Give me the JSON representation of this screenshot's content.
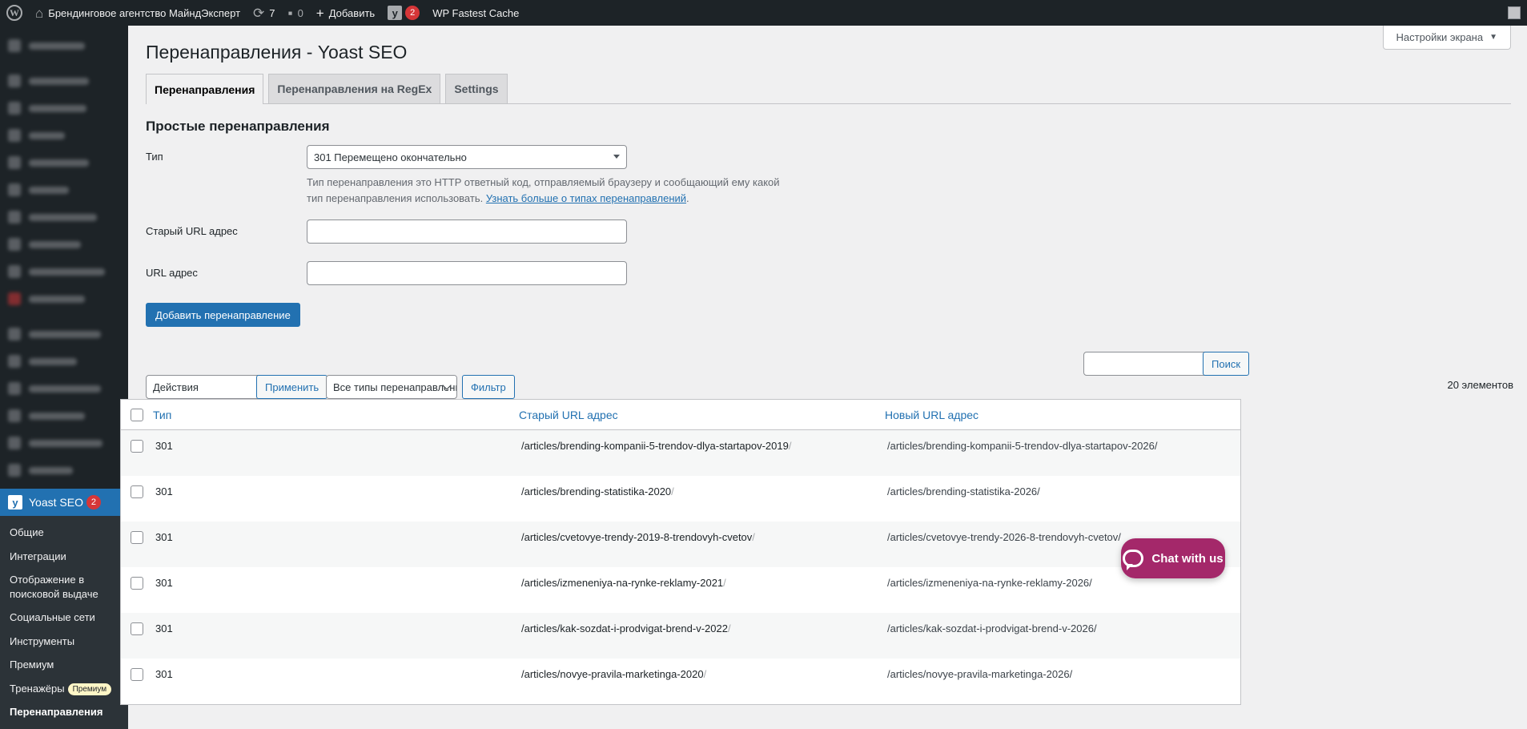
{
  "adminbar": {
    "site_name": "Брендинговое агентство МайндЭксперт",
    "updates_count": "7",
    "comments_count": "0",
    "add_label": "Добавить",
    "yoast_badge": "2",
    "cache_label": "WP Fastest Cache"
  },
  "sidebar": {
    "yoast_label": "Yoast SEO",
    "yoast_badge": "2",
    "submenu": [
      "Общие",
      "Интеграции",
      "Отображение в поисковой выдаче",
      "Социальные сети",
      "Инструменты",
      "Премиум",
      "Тренажёры",
      "Перенаправления"
    ],
    "premium_badge": "Премиум"
  },
  "header": {
    "screen_options": "Настройки экрана",
    "title": "Перенаправления - Yoast SEO"
  },
  "tabs": [
    {
      "label": "Перенаправления",
      "active": true
    },
    {
      "label": "Перенаправления на RegEx",
      "active": false
    },
    {
      "label": "Settings",
      "active": false
    }
  ],
  "form": {
    "section_title": "Простые перенаправления",
    "type_label": "Тип",
    "type_value": "301 Перемещено окончательно",
    "desc_line1": "Тип перенаправления это HTTP ответный код, отправляемый браузеру и сообщающий ему какой",
    "desc_line2": "тип перенаправления использовать.",
    "desc_link": "Узнать больше о типах перенаправлений",
    "old_url_label": "Старый URL адрес",
    "old_url_value": "",
    "url_label": "URL адрес",
    "url_value": "",
    "add_button": "Добавить перенаправление"
  },
  "list": {
    "search_button": "Поиск",
    "search_value": "",
    "bulk_action": "Действия",
    "apply_button": "Применить",
    "type_filter": "Все типы перенаправлений",
    "filter_button": "Фильтр",
    "count": "20 элементов",
    "columns": {
      "type": "Тип",
      "old": "Старый URL адрес",
      "new": "Новый URL адрес"
    },
    "rows": [
      {
        "type": "301",
        "old": "/articles/brending-kompanii-5-trendov-dlya-startapov-2019",
        "new": "/articles/brending-kompanii-5-trendov-dlya-startapov-2026/"
      },
      {
        "type": "301",
        "old": "/articles/brending-statistika-2020",
        "new": "/articles/brending-statistika-2026/"
      },
      {
        "type": "301",
        "old": "/articles/cvetovye-trendy-2019-8-trendovyh-cvetov",
        "new": "/articles/cvetovye-trendy-2026-8-trendovyh-cvetov/"
      },
      {
        "type": "301",
        "old": "/articles/izmeneniya-na-rynke-reklamy-2021",
        "new": "/articles/izmeneniya-na-rynke-reklamy-2026/"
      },
      {
        "type": "301",
        "old": "/articles/kak-sozdat-i-prodvigat-brend-v-2022",
        "new": "/articles/kak-sozdat-i-prodvigat-brend-v-2026/"
      },
      {
        "type": "301",
        "old": "/articles/novye-pravila-marketinga-2020",
        "new": "/articles/novye-pravila-marketinga-2026/"
      }
    ]
  },
  "chat": {
    "label": "Chat with us"
  }
}
